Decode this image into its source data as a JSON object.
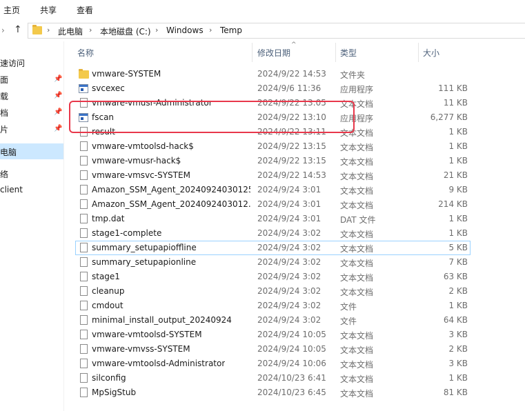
{
  "ribbon": {
    "tabs": [
      "主页",
      "共享",
      "查看"
    ]
  },
  "address": {
    "up_glyph": "↑",
    "back_glyph": "‹",
    "forward_glyph": "›",
    "crumbs": [
      "此电脑",
      "本地磁盘 (C:)",
      "Windows",
      "Temp"
    ],
    "separator": "›"
  },
  "sidebar": {
    "items": [
      {
        "label": "速访问",
        "pinned": false
      },
      {
        "label": "面",
        "pinned": true
      },
      {
        "label": "载",
        "pinned": true
      },
      {
        "label": "档",
        "pinned": true
      },
      {
        "label": "片",
        "pinned": true
      },
      {
        "label": "电脑",
        "pinned": false,
        "selected": true
      },
      {
        "label": "络",
        "pinned": false
      },
      {
        "label": "client",
        "pinned": false
      }
    ],
    "pin_glyph": "📌"
  },
  "columns": {
    "name": "名称",
    "date": "修改日期",
    "type": "类型",
    "size": "大小",
    "sort_glyph": "^"
  },
  "files": [
    {
      "name": "vmware-SYSTEM",
      "date": "2024/9/22 14:53",
      "type": "文件夹",
      "size": "",
      "icon": "folder"
    },
    {
      "name": "svcexec",
      "date": "2024/9/6 11:36",
      "type": "应用程序",
      "size": "111 KB",
      "icon": "exe"
    },
    {
      "name": "vmware-vmusr-Administrator",
      "date": "2024/9/22 13:05",
      "type": "文本文档",
      "size": "11 KB",
      "icon": "doc"
    },
    {
      "name": "fscan",
      "date": "2024/9/22 13:10",
      "type": "应用程序",
      "size": "6,277 KB",
      "icon": "exe"
    },
    {
      "name": "result",
      "date": "2024/9/22 13:11",
      "type": "文本文档",
      "size": "1 KB",
      "icon": "doc"
    },
    {
      "name": "vmware-vmtoolsd-hack$",
      "date": "2024/9/22 13:15",
      "type": "文本文档",
      "size": "1 KB",
      "icon": "doc"
    },
    {
      "name": "vmware-vmusr-hack$",
      "date": "2024/9/22 13:15",
      "type": "文本文档",
      "size": "1 KB",
      "icon": "doc"
    },
    {
      "name": "vmware-vmsvc-SYSTEM",
      "date": "2024/9/22 14:53",
      "type": "文本文档",
      "size": "21 KB",
      "icon": "doc"
    },
    {
      "name": "Amazon_SSM_Agent_20240924030125",
      "date": "2024/9/24 3:01",
      "type": "文本文档",
      "size": "9 KB",
      "icon": "doc"
    },
    {
      "name": "Amazon_SSM_Agent_2024092403012...",
      "date": "2024/9/24 3:01",
      "type": "文本文档",
      "size": "214 KB",
      "icon": "doc"
    },
    {
      "name": "tmp.dat",
      "date": "2024/9/24 3:01",
      "type": "DAT 文件",
      "size": "1 KB",
      "icon": "doc"
    },
    {
      "name": "stage1-complete",
      "date": "2024/9/24 3:02",
      "type": "文本文档",
      "size": "1 KB",
      "icon": "doc"
    },
    {
      "name": "summary_setupapioffline",
      "date": "2024/9/24 3:02",
      "type": "文本文档",
      "size": "5 KB",
      "icon": "doc",
      "focused": true
    },
    {
      "name": "summary_setupapionline",
      "date": "2024/9/24 3:02",
      "type": "文本文档",
      "size": "7 KB",
      "icon": "doc"
    },
    {
      "name": "stage1",
      "date": "2024/9/24 3:02",
      "type": "文本文档",
      "size": "63 KB",
      "icon": "doc"
    },
    {
      "name": "cleanup",
      "date": "2024/9/24 3:02",
      "type": "文本文档",
      "size": "2 KB",
      "icon": "doc"
    },
    {
      "name": "cmdout",
      "date": "2024/9/24 3:02",
      "type": "文件",
      "size": "1 KB",
      "icon": "doc"
    },
    {
      "name": "minimal_install_output_20240924",
      "date": "2024/9/24 3:02",
      "type": "文件",
      "size": "64 KB",
      "icon": "doc"
    },
    {
      "name": "vmware-vmtoolsd-SYSTEM",
      "date": "2024/9/24 10:05",
      "type": "文本文档",
      "size": "3 KB",
      "icon": "doc"
    },
    {
      "name": "vmware-vmvss-SYSTEM",
      "date": "2024/9/24 10:05",
      "type": "文本文档",
      "size": "2 KB",
      "icon": "doc"
    },
    {
      "name": "vmware-vmtoolsd-Administrator",
      "date": "2024/9/24 10:06",
      "type": "文本文档",
      "size": "3 KB",
      "icon": "doc"
    },
    {
      "name": "silconfig",
      "date": "2024/10/23 6:41",
      "type": "文本文档",
      "size": "1 KB",
      "icon": "doc"
    },
    {
      "name": "MpSigStub",
      "date": "2024/10/23 6:45",
      "type": "文本文档",
      "size": "81 KB",
      "icon": "doc"
    }
  ],
  "colors": {
    "highlight": "#e8374a",
    "selected": "#cce8ff",
    "folder": "#f3c94b"
  }
}
